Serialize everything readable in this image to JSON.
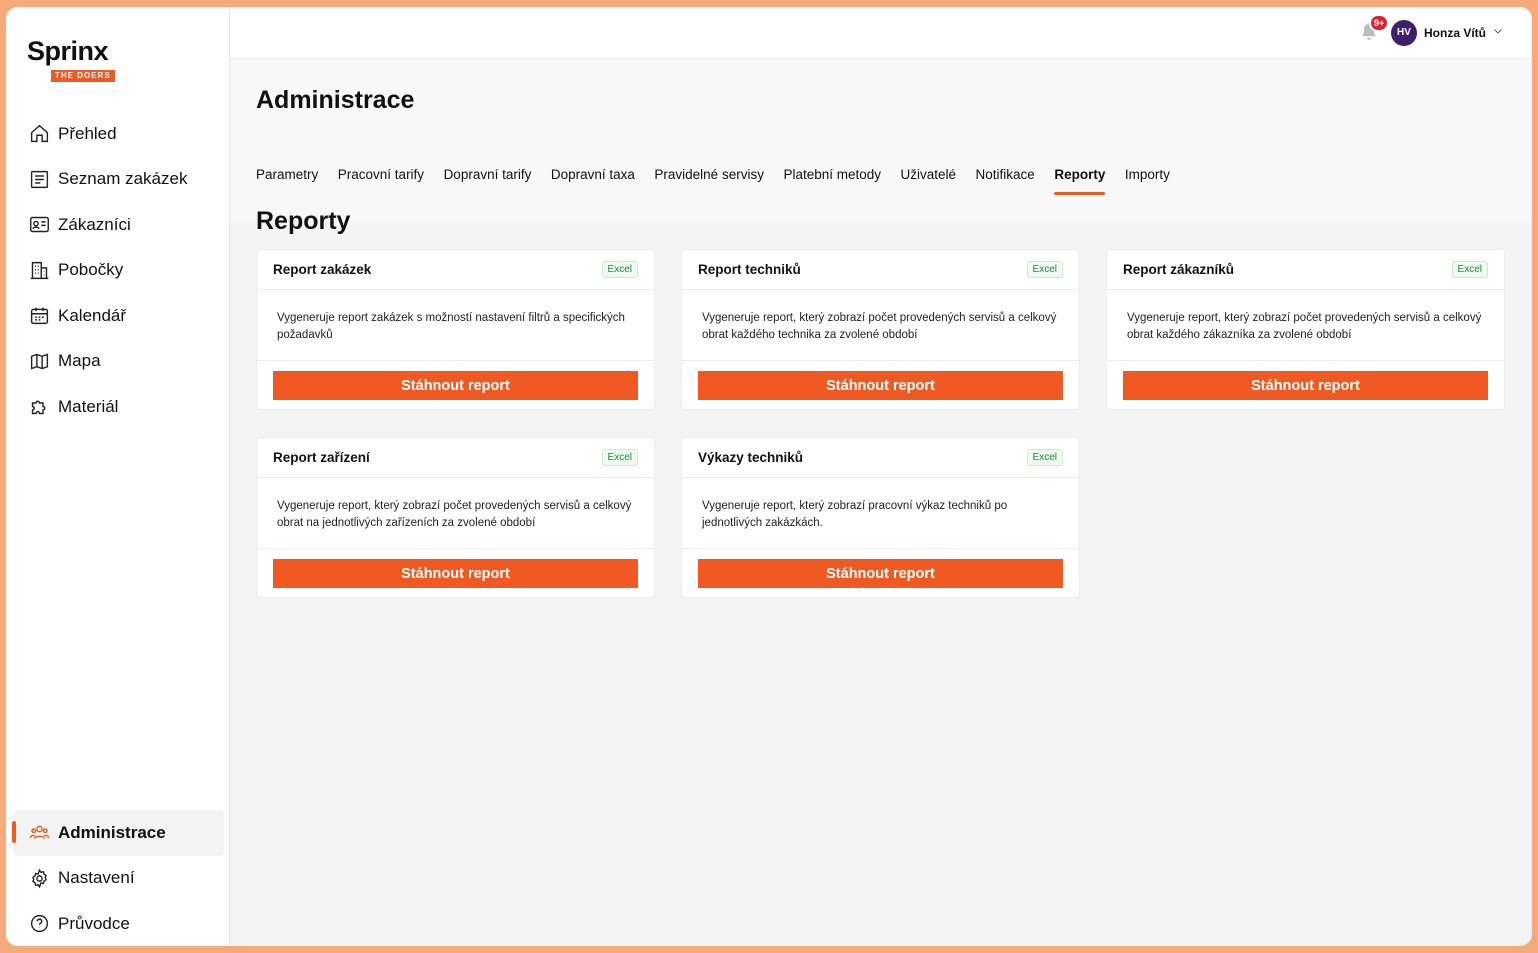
{
  "brand": {
    "name": "Sprinx",
    "tagline": "THE DOERS"
  },
  "sidebar": {
    "items": [
      {
        "label": "Přehled",
        "icon": "home-icon"
      },
      {
        "label": "Seznam zakázek",
        "icon": "list-icon"
      },
      {
        "label": "Zákazníci",
        "icon": "id-card-icon"
      },
      {
        "label": "Pobočky",
        "icon": "building-icon"
      },
      {
        "label": "Kalendář",
        "icon": "calendar-icon"
      },
      {
        "label": "Mapa",
        "icon": "map-icon"
      },
      {
        "label": "Materiál",
        "icon": "puzzle-icon"
      }
    ],
    "bottom_items": [
      {
        "label": "Administrace",
        "icon": "users-icon",
        "active": true
      },
      {
        "label": "Nastavení",
        "icon": "gear-icon"
      },
      {
        "label": "Průvodce",
        "icon": "help-icon"
      }
    ]
  },
  "topbar": {
    "notifications_badge": "9+",
    "user_initials": "HV",
    "user_name": "Honza Vítů"
  },
  "page": {
    "title": "Administrace",
    "tabs": [
      "Parametry",
      "Pracovní tarify",
      "Dopravní tarify",
      "Dopravní taxa",
      "Pravidelné servisy",
      "Platební metody",
      "Uživatelé",
      "Notifikace",
      "Reporty",
      "Importy"
    ],
    "active_tab": "Reporty"
  },
  "reports": {
    "title": "Reporty",
    "cards": [
      {
        "title": "Report zakázek",
        "format": "Excel",
        "description": "Vygeneruje report zakázek s možností nastavení filtrů a specifických požadavků",
        "button": "Stáhnout report"
      },
      {
        "title": "Report techniků",
        "format": "Excel",
        "description": "Vygeneruje report, který zobrazí počet provedených servisů a celkový obrat každého technika za zvolené období",
        "button": "Stáhnout report"
      },
      {
        "title": "Report zákazníků",
        "format": "Excel",
        "description": "Vygeneruje report, který zobrazí počet provedených servisů a celkový obrat každého zákazníka za zvolené období",
        "button": "Stáhnout report"
      },
      {
        "title": "Report zařízení",
        "format": "Excel",
        "description": "Vygeneruje report, který zobrazí počet provedených servisů a celkový obrat na jednotlivých zařízeních za zvolené období",
        "button": "Stáhnout report"
      },
      {
        "title": "Výkazy techniků",
        "format": "Excel",
        "description": "Vygeneruje report, který zobrazí pracovní výkaz techniků po jednotlivých zakázkách.",
        "button": "Stáhnout report"
      }
    ]
  },
  "colors": {
    "accent": "#f05a22",
    "active_indicator": "#ee5a24",
    "avatar": "#3d1f6e",
    "excel_text": "#1f8a3b"
  }
}
